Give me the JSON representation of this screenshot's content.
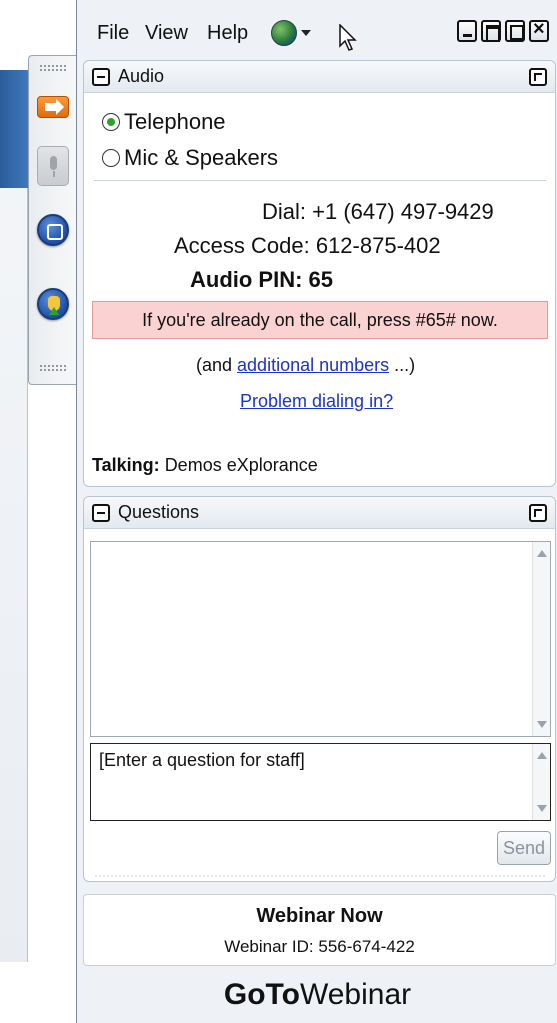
{
  "menu": {
    "file": "File",
    "view": "View",
    "help": "Help"
  },
  "audio": {
    "title": "Audio",
    "options": [
      {
        "label": "Telephone",
        "checked": true
      },
      {
        "label": "Mic & Speakers",
        "checked": false
      }
    ],
    "dial": "Dial: +1 (647) 497-9429",
    "access_code": "Access Code: 612-875-402",
    "audio_pin": "Audio PIN: 65",
    "notice": "If you're already on the call, press #65# now.",
    "additional_prefix": "(and ",
    "additional_link": "additional numbers",
    "additional_suffix": " ...)",
    "problem_link": "Problem dialing in?",
    "talking_label": "Talking:",
    "talking_name": "Demos eXplorance",
    "notice_color": "#fbd2d2"
  },
  "questions": {
    "title": "Questions",
    "input_placeholder": "[Enter a question for staff]",
    "send_label": "Send"
  },
  "footer": {
    "webinar_name": "Webinar Now",
    "webinar_id": "Webinar ID: 556-674-422",
    "logo_bold": "GoTo",
    "logo_rest": "Webinar"
  },
  "icons": {
    "grab_tab_arrow": "orange-arrow-icon",
    "mic": "microphone-icon",
    "screen": "screen-share-icon",
    "hand": "raise-hand-icon",
    "globe": "globe-icon"
  }
}
